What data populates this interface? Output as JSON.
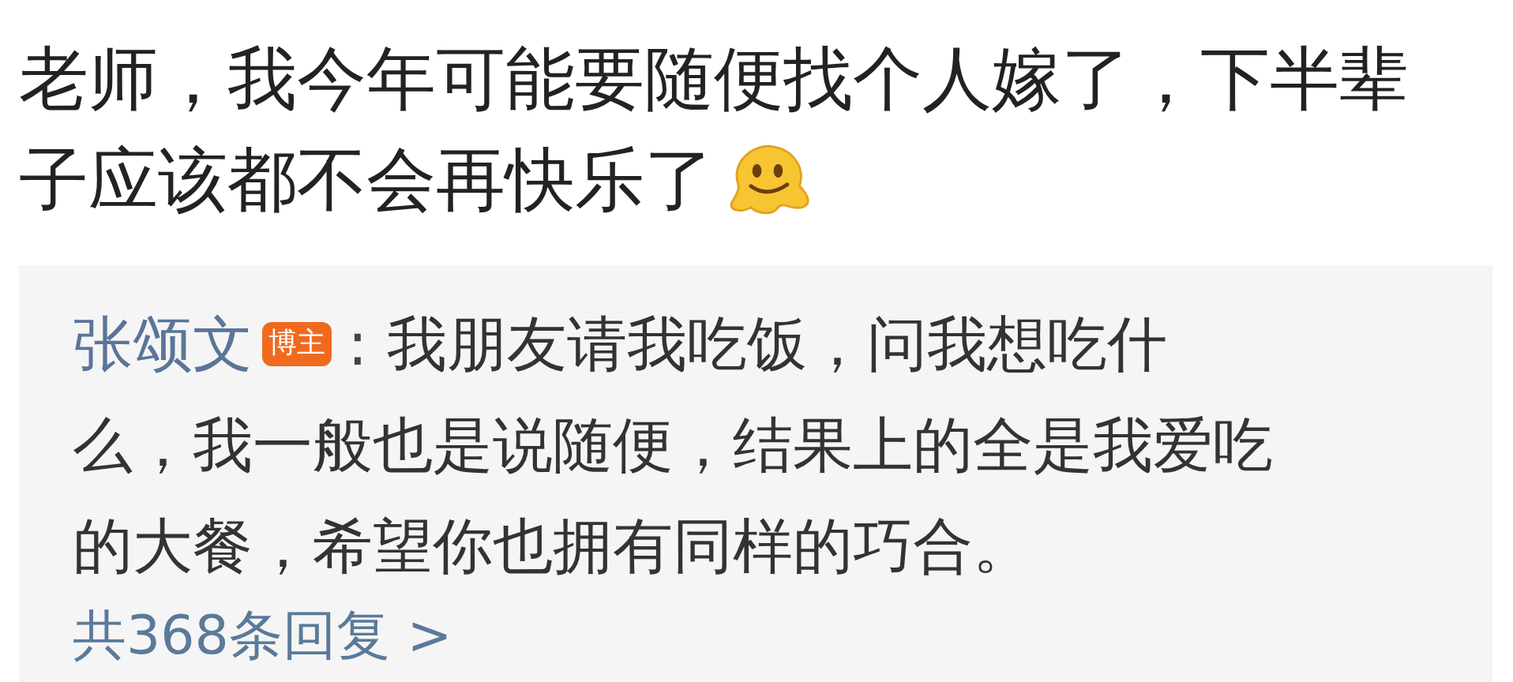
{
  "comment": {
    "lines": [
      "老师，我今年可能要随便找个人嫁了，下半辈",
      "子应该都不会再快乐了"
    ]
  },
  "reply": {
    "author": "张颂文",
    "badge": "博主",
    "separator": ":",
    "lines": [
      "我朋友请我吃饭，问我想吃什",
      "么，我一般也是说随便，结果上的全是我爱吃",
      "的大餐，希望你也拥有同样的巧合。"
    ]
  },
  "more_replies": "共368条回复 >"
}
